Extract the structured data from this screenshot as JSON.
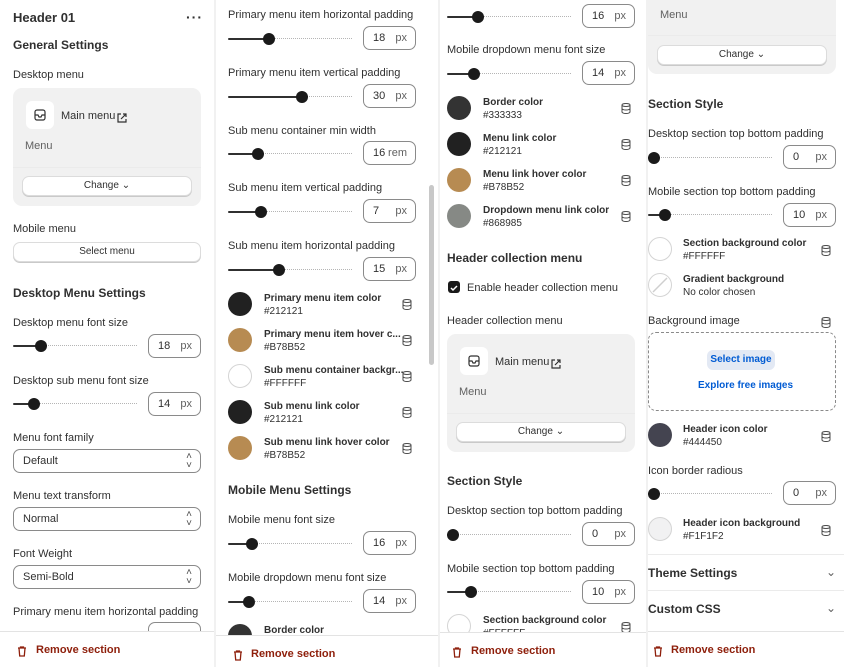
{
  "colors": {
    "accent": "#303030",
    "danger": "#8e1f0b",
    "link": "#005bd3"
  },
  "p1": {
    "header_title": "Header 01",
    "more_icon": "more-horizontal-icon",
    "general_settings": "General Settings",
    "desktop_menu_label": "Desktop menu",
    "main_menu": "Main menu",
    "menu_sub": "Menu",
    "change_label": "Change",
    "mobile_menu_label": "Mobile menu",
    "select_menu": "Select menu",
    "desktop_menu_settings": "Desktop Menu Settings",
    "desktop_menu_font_size": {
      "label": "Desktop menu font size",
      "value": "18",
      "unit": "px"
    },
    "desktop_sub_menu_font_size": {
      "label": "Desktop sub menu font size",
      "value": "14",
      "unit": "px"
    },
    "menu_font_family": {
      "label": "Menu font family",
      "value": "Default"
    },
    "menu_text_transform": {
      "label": "Menu text transform",
      "value": "Normal"
    },
    "font_weight": {
      "label": "Font Weight",
      "value": "Semi-Bold"
    },
    "primary_h_padding_label": "Primary menu item horizontal padding",
    "remove_section": "Remove section"
  },
  "p2": {
    "sliders": [
      {
        "label": "Primary menu item horizontal padding",
        "value": "18",
        "unit": "px"
      },
      {
        "label": "Primary menu item vertical padding",
        "value": "30",
        "unit": "px"
      },
      {
        "label": "Sub menu container min width",
        "value": "16",
        "unit": "rem"
      },
      {
        "label": "Sub menu item vertical padding",
        "value": "7",
        "unit": "px"
      },
      {
        "label": "Sub menu item horizontal padding",
        "value": "15",
        "unit": "px"
      }
    ],
    "colors": [
      {
        "name": "Primary menu item color",
        "hex": "#212121",
        "swatch": "#212121"
      },
      {
        "name": "Primary menu item hover c...",
        "hex": "#B78B52",
        "swatch": "#B78B52"
      },
      {
        "name": "Sub menu container backgr...",
        "hex": "#FFFFFF",
        "swatch": "#FFFFFF"
      },
      {
        "name": "Sub menu link color",
        "hex": "#212121",
        "swatch": "#212121"
      },
      {
        "name": "Sub menu link hover color",
        "hex": "#B78B52",
        "swatch": "#B78B52"
      }
    ],
    "mobile_menu_settings": "Mobile Menu Settings",
    "mobile_menu_font_size": {
      "label": "Mobile menu font size",
      "value": "16",
      "unit": "px"
    },
    "mobile_dropdown_font_size": {
      "label": "Mobile dropdown menu font size",
      "value": "14",
      "unit": "px"
    },
    "border_color_label": "Border color",
    "remove_section": "Remove section"
  },
  "p3": {
    "top_slider": {
      "value": "16",
      "unit": "px"
    },
    "mobile_dropdown_font_size": {
      "label": "Mobile dropdown menu font size",
      "value": "14",
      "unit": "px"
    },
    "colors": [
      {
        "name": "Border color",
        "hex": "#333333",
        "swatch": "#333333"
      },
      {
        "name": "Menu link color",
        "hex": "#212121",
        "swatch": "#212121"
      },
      {
        "name": "Menu link hover color",
        "hex": "#B78B52",
        "swatch": "#B78B52"
      },
      {
        "name": "Dropdown menu link color",
        "hex": "#868985",
        "swatch": "#868985"
      }
    ],
    "header_collection_menu": "Header collection menu",
    "enable_collection_menu": "Enable header collection menu",
    "collection_menu_label": "Header collection menu",
    "main_menu": "Main menu",
    "menu_sub": "Menu",
    "change_label": "Change",
    "section_style": "Section Style",
    "desktop_padding": {
      "label": "Desktop section top bottom padding",
      "value": "0",
      "unit": "px"
    },
    "mobile_padding": {
      "label": "Mobile section top bottom padding",
      "value": "10",
      "unit": "px"
    },
    "section_bg_label": "Section background color",
    "section_bg_hex": "#FFFFFF",
    "remove_section": "Remove section"
  },
  "p4": {
    "menu_sub": "Menu",
    "change_label": "Change",
    "section_style": "Section Style",
    "desktop_padding": {
      "label": "Desktop section top bottom padding",
      "value": "0",
      "unit": "px"
    },
    "mobile_padding": {
      "label": "Mobile section top bottom padding",
      "value": "10",
      "unit": "px"
    },
    "section_bg": {
      "name": "Section background color",
      "hex": "#FFFFFF"
    },
    "gradient_bg": {
      "name": "Gradient background",
      "hex": "No color chosen"
    },
    "background_image": "Background image",
    "select_image": "Select image",
    "explore_images": "Explore free images",
    "header_icon_color": {
      "name": "Header icon color",
      "hex": "#444450"
    },
    "icon_border_radius": {
      "label": "Icon border radious",
      "value": "0",
      "unit": "px"
    },
    "header_icon_bg": {
      "name": "Header icon background",
      "hex": "#F1F1F2"
    },
    "theme_settings": "Theme Settings",
    "custom_css": "Custom CSS",
    "remove_section": "Remove section"
  }
}
